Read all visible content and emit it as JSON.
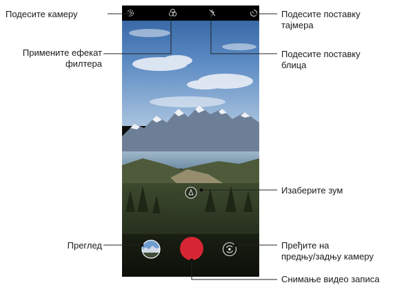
{
  "callouts": {
    "adjust_camera": "Подесите камеру",
    "apply_filter_line1": "Примените ефекат",
    "apply_filter_line2": "филтера",
    "preview": "Преглед",
    "timer_line1": "Подесите поставку",
    "timer_line2": "тајмера",
    "flash_line1": "Подесите поставку",
    "flash_line2": "блица",
    "zoom": "Изаберите зум",
    "switch_line1": "Пређите на",
    "switch_line2": "предњу/задњу камеру",
    "record": "Снимање видео записа"
  },
  "colors": {
    "record": "#d62633",
    "leader": "#222222",
    "dot": "#111111"
  },
  "icons": {
    "settings": "gear-icon",
    "filter": "filter-icon",
    "flash": "flash-off-icon",
    "timer": "timer-icon",
    "zoom": "zoom-icon",
    "gallery": "gallery-thumbnail",
    "record": "record-button",
    "switch": "switch-camera-icon"
  }
}
